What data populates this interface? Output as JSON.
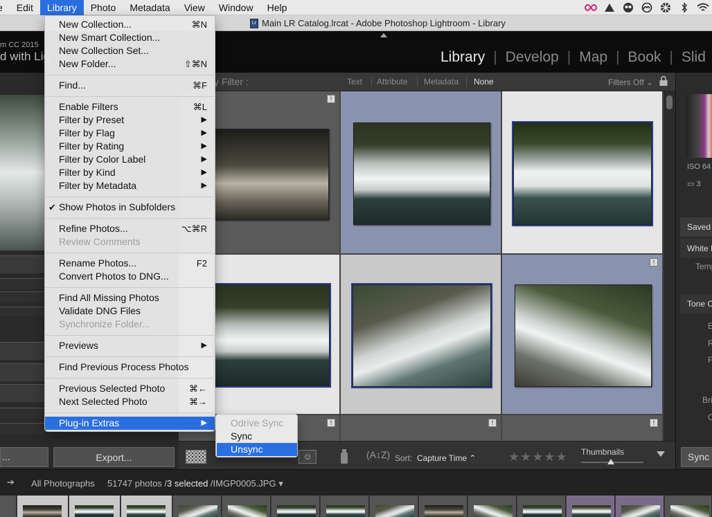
{
  "menubar": {
    "items": [
      "Edit",
      "Library",
      "Photo",
      "Metadata",
      "View",
      "Window",
      "Help"
    ],
    "active_index": 1,
    "partial_left": "e"
  },
  "window": {
    "title": "Main LR Catalog.lrcat - Adobe Photoshop Lightroom - Library"
  },
  "identity_plate": {
    "line1": "m CC 2015",
    "line2": "d with Lig"
  },
  "modules": {
    "items": [
      "Library",
      "Develop",
      "Map",
      "Book",
      "Slid"
    ],
    "active": "Library"
  },
  "filter_bar": {
    "label": "y Filter :",
    "options": [
      "Text",
      "Attribute",
      "Metadata",
      "None"
    ],
    "active": "None",
    "filters_state": "Filters Off"
  },
  "library_menu": {
    "groups": [
      [
        {
          "label": "New Collection...",
          "shortcut": "⌘N"
        },
        {
          "label": "New Smart Collection...",
          "shortcut": ""
        },
        {
          "label": "New Collection Set...",
          "shortcut": ""
        },
        {
          "label": "New Folder...",
          "shortcut": "⇧⌘N"
        }
      ],
      [
        {
          "label": "Find...",
          "shortcut": "⌘F"
        }
      ],
      [
        {
          "label": "Enable Filters",
          "shortcut": "⌘L"
        },
        {
          "label": "Filter by Preset",
          "submenu": true
        },
        {
          "label": "Filter by Flag",
          "submenu": true
        },
        {
          "label": "Filter by Rating",
          "submenu": true
        },
        {
          "label": "Filter by Color Label",
          "submenu": true
        },
        {
          "label": "Filter by Kind",
          "submenu": true
        },
        {
          "label": "Filter by Metadata",
          "submenu": true
        }
      ],
      [
        {
          "label": "Show Photos in Subfolders",
          "checked": true
        }
      ],
      [
        {
          "label": "Refine Photos...",
          "shortcut": "⌥⌘R"
        },
        {
          "label": "Review Comments",
          "disabled": true
        }
      ],
      [
        {
          "label": "Rename Photos...",
          "shortcut": "F2"
        },
        {
          "label": "Convert Photos to DNG..."
        }
      ],
      [
        {
          "label": "Find All Missing Photos"
        },
        {
          "label": "Validate DNG Files"
        },
        {
          "label": "Synchronize Folder...",
          "disabled": true
        }
      ],
      [
        {
          "label": "Previews",
          "submenu": true
        }
      ],
      [
        {
          "label": "Find Previous Process Photos"
        }
      ],
      [
        {
          "label": "Previous Selected Photo",
          "shortcut": "⌘←"
        },
        {
          "label": "Next Selected Photo",
          "shortcut": "⌘→"
        }
      ],
      [
        {
          "label": "Plug-in Extras",
          "submenu": true,
          "highlighted": true
        }
      ]
    ]
  },
  "plugin_submenu": {
    "items": [
      {
        "label": "Odrive Sync",
        "disabled": true
      },
      {
        "label": "Sync"
      },
      {
        "label": "Unsync",
        "highlighted": true
      }
    ]
  },
  "toolbar": {
    "sort_label": "Sort:",
    "sort_value": "Capture Time",
    "stars": "★★★★★",
    "thumbnails_label": "Thumbnails",
    "thumbnails_level": 0.42
  },
  "left_panel": {
    "export_label": "Export...",
    "import_label": "..."
  },
  "right_panel": {
    "iso": "ISO 64",
    "crop_count": "3",
    "items": [
      "Saved I",
      "White E",
      "Temp",
      "Tone C",
      "E",
      "R",
      "F",
      "Bri",
      "C"
    ],
    "sync_label": "Sync N"
  },
  "status_bar": {
    "source": "All Photographs",
    "count": "51747 photos /",
    "selected": "3 selected",
    "file": "/IMGP0005.JPG"
  },
  "badge_glyph": "!",
  "colors": {
    "selection_blue": "#2a6fe0",
    "selected_cell": "#8a93ad"
  }
}
